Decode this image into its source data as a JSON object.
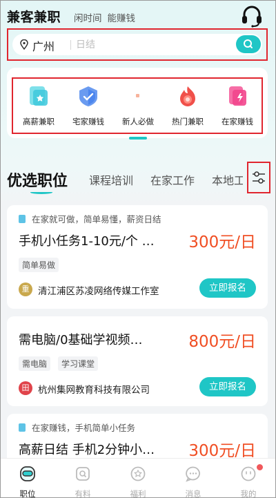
{
  "header": {
    "brand": "兼客兼职",
    "slogan_1": "闲时间",
    "slogan_2": "能赚钱",
    "service_icon": "headset-icon"
  },
  "search": {
    "city": "广州",
    "placeholder": "日结",
    "location_icon": "location-pin-icon",
    "search_icon": "search-icon"
  },
  "categories": [
    {
      "label": "高薪兼职",
      "icon": "high-salary-icon"
    },
    {
      "label": "宅家赚钱",
      "icon": "home-earn-icon"
    },
    {
      "label": "新人必做",
      "icon": "newcomer-icon"
    },
    {
      "label": "热门兼职",
      "icon": "hot-job-icon"
    },
    {
      "label": "在家赚钱",
      "icon": "work-from-home-icon"
    }
  ],
  "tabs": [
    {
      "label": "优选职位",
      "active": true
    },
    {
      "label": "课程培训",
      "active": false
    },
    {
      "label": "在家工作",
      "active": false
    },
    {
      "label": "本地工",
      "active": false
    }
  ],
  "filter_icon": "filter-sliders-icon",
  "jobs": [
    {
      "tip": "在家就可做，简单易懂，薪资日结",
      "title": "手机小任务1-10元/个 …",
      "salary": "300元/日",
      "tags": [
        "简单易做"
      ],
      "company_logo_char": "重",
      "company_logo_color": "#c9a84d",
      "company": "清江浦区苏凌网络传媒工作室",
      "apply": "立即报名"
    },
    {
      "tip": "",
      "title": "需电脑/0基础学视频…",
      "salary": "800元/日",
      "tags": [
        "需电脑",
        "学习课堂"
      ],
      "company_logo_char": "田",
      "company_logo_color": "#e0434a",
      "company": "杭州集网教育科技有限公司",
      "apply": "立即报名"
    },
    {
      "tip": "在家赚钱，手机简单小任务",
      "title": "高薪日结 手机2分钟小…",
      "salary": "300元/日",
      "tags": [],
      "company_logo_char": "",
      "company_logo_color": "",
      "company": "",
      "apply": ""
    }
  ],
  "nav": [
    {
      "label": "职位",
      "icon": "jobs-icon",
      "active": true
    },
    {
      "label": "有料",
      "icon": "content-icon",
      "active": false
    },
    {
      "label": "福利",
      "icon": "welfare-icon",
      "active": false
    },
    {
      "label": "消息",
      "icon": "message-icon",
      "active": false
    },
    {
      "label": "我的",
      "icon": "profile-icon",
      "active": false
    }
  ],
  "colors": {
    "accent": "#1fc6c6",
    "salary": "#f04e23",
    "highlight_border": "#e0252e"
  }
}
